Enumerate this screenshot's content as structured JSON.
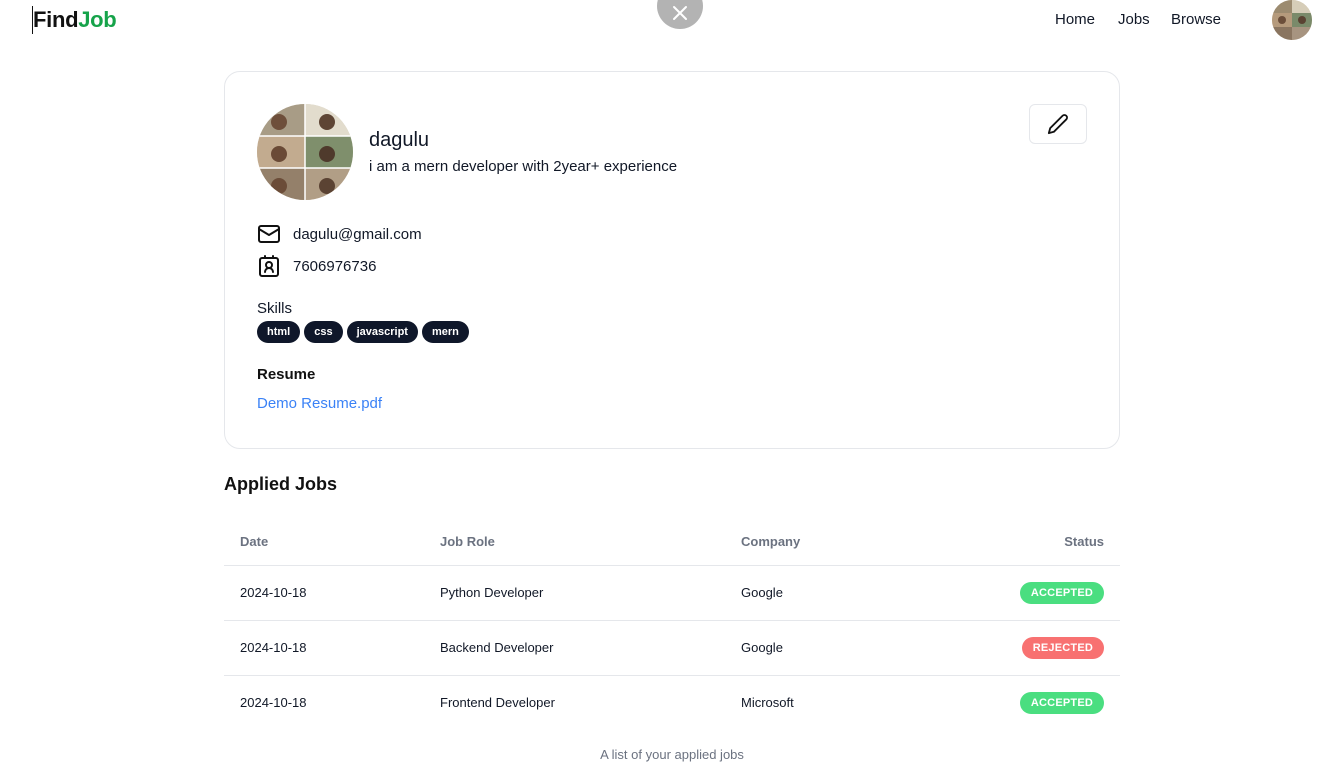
{
  "navbar": {
    "logo_find": "Find",
    "logo_job": "Job",
    "links": [
      "Home",
      "Jobs",
      "Browse"
    ]
  },
  "profile": {
    "name": "dagulu",
    "bio": "i am a mern developer with 2year+ experience",
    "email": "dagulu@gmail.com",
    "phone": "7606976736",
    "skills_label": "Skills",
    "skills": [
      "html",
      "css",
      "javascript",
      "mern"
    ],
    "resume_label": "Resume",
    "resume_file": "Demo Resume.pdf"
  },
  "applied_jobs": {
    "title": "Applied Jobs",
    "headers": {
      "date": "Date",
      "role": "Job Role",
      "company": "Company",
      "status": "Status"
    },
    "rows": [
      {
        "date": "2024-10-18",
        "role": "Python Developer",
        "company": "Google",
        "status": "ACCEPTED"
      },
      {
        "date": "2024-10-18",
        "role": "Backend Developer",
        "company": "Google",
        "status": "REJECTED"
      },
      {
        "date": "2024-10-18",
        "role": "Frontend Developer",
        "company": "Microsoft",
        "status": "ACCEPTED"
      }
    ],
    "caption": "A list of your applied jobs"
  },
  "colors": {
    "brand_green": "#16a34a",
    "accepted": "#4ade80",
    "rejected": "#f87171",
    "link": "#3b82f6",
    "badge_dark": "#0f172a"
  },
  "icons": [
    "close-icon",
    "pencil-icon",
    "mail-icon",
    "contact-icon"
  ]
}
